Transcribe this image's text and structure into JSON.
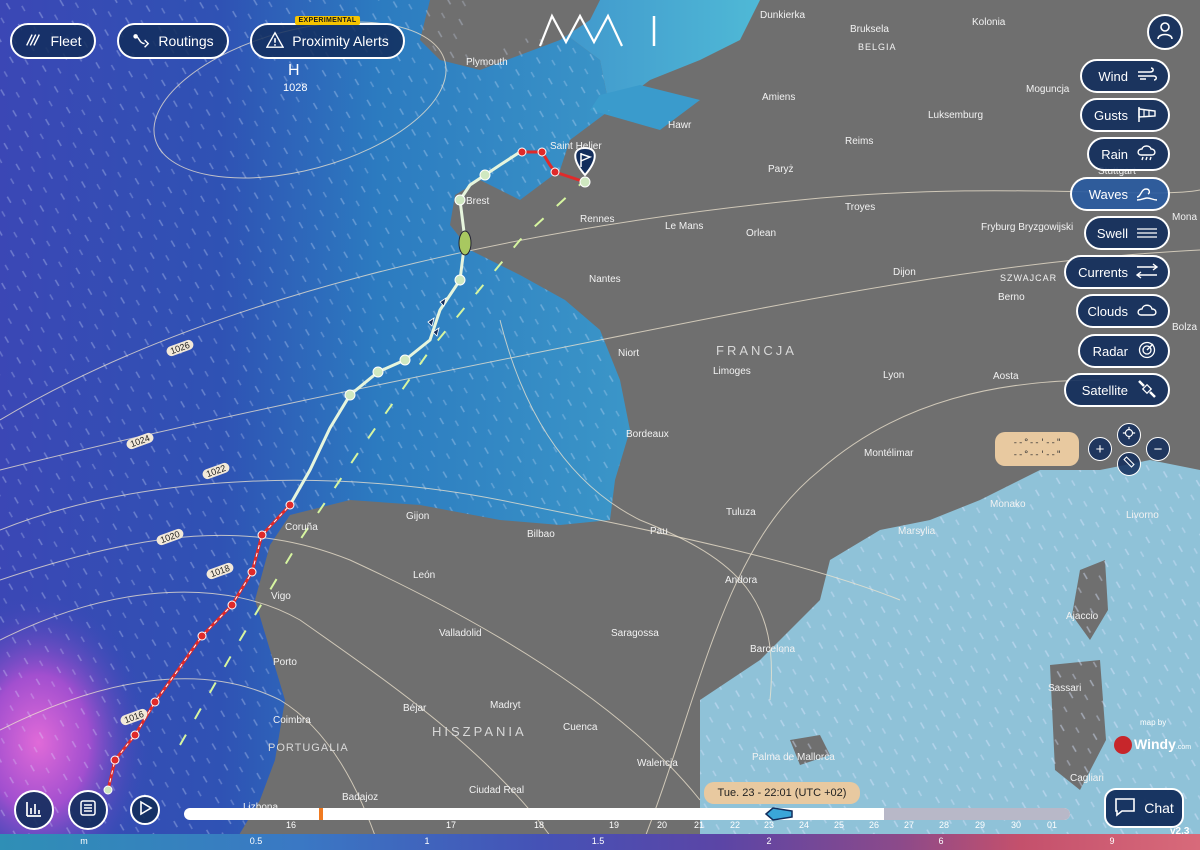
{
  "header": {
    "fleet_label": "Fleet",
    "routings_label": "Routings",
    "proximity_label": "Proximity Alerts",
    "proximity_badge": "EXPERIMENTAL",
    "logo_text": "MWI"
  },
  "layers": [
    {
      "label": "Wind",
      "icon": "wind-icon"
    },
    {
      "label": "Gusts",
      "icon": "windsock-icon"
    },
    {
      "label": "Rain",
      "icon": "rain-cloud-icon"
    },
    {
      "label": "Waves",
      "icon": "waves-icon"
    },
    {
      "label": "Swell",
      "icon": "swell-icon"
    },
    {
      "label": "Currents",
      "icon": "currents-icon"
    },
    {
      "label": "Clouds",
      "icon": "cloud-icon"
    },
    {
      "label": "Radar",
      "icon": "radar-icon"
    },
    {
      "label": "Satellite",
      "icon": "satellite-icon"
    }
  ],
  "coords": {
    "line1": "--°--'--\"",
    "line2": "--°--'--\""
  },
  "pressure": {
    "symbol": "H",
    "value": "1028"
  },
  "isobars": [
    "1026",
    "1024",
    "1022",
    "1020",
    "1018",
    "1016"
  ],
  "places": {
    "plymouth": "Plymouth",
    "dunkierka": "Dunkierka",
    "bruksela": "Bruksela",
    "belgia": "BELGIA",
    "kolonia": "Kolonia",
    "moguncja": "Moguncja",
    "amiens": "Amiens",
    "hawr": "Hawr",
    "luksemburg": "Luksemburg",
    "reims": "Reims",
    "paryz": "Paryż",
    "saint_helier": "Saint Helier",
    "brest": "Brest",
    "rennes": "Rennes",
    "le_mans": "Le Mans",
    "orlean": "Orlean",
    "troyes": "Troyes",
    "stuttgart": "Stuttgart",
    "fryburg": "Fryburg Bryzgowijski",
    "monachium": "Mona",
    "nantes": "Nantes",
    "dijon": "Dijon",
    "szwajcaria": "SZWAJCAR",
    "berno": "Berno",
    "bolzano": "Bolza",
    "niort": "Niort",
    "limoges": "Limoges",
    "lyon": "Lyon",
    "aosta": "Aosta",
    "bordeaux": "Bordeaux",
    "montelimar": "Montélimar",
    "tuluza": "Tuluza",
    "monako": "Monako",
    "livorno": "Livorno",
    "marsylia": "Marsylia",
    "pau": "Pau",
    "bilbao": "Bilbao",
    "gijon": "Gijon",
    "coruna": "Coruña",
    "vigo": "Vigo",
    "leon": "León",
    "andora": "Andora",
    "ajaccio": "Ajaccio",
    "valladolid": "Valladolid",
    "saragossa": "Saragossa",
    "barcelona": "Barcelona",
    "porto": "Porto",
    "sassari": "Sassari",
    "madryt": "Madryt",
    "bejar": "Béjar",
    "cuenca": "Cuenca",
    "coimbra": "Coimbra",
    "palma": "Palma de Mallorca",
    "walencja": "Walencja",
    "cagliari": "Cagliari",
    "ciudad_real": "Ciudad Real",
    "badajoz": "Badajoz",
    "lizbona": "Lizbona"
  },
  "countries": {
    "francja": "FRANCJA",
    "hiszpania": "HISZPANIA",
    "portugalia": "PORTUGALIA"
  },
  "attribution": {
    "map_by": "map by",
    "brand": "Windy",
    "brand_suffix": ".com"
  },
  "time": {
    "current": "Tue. 23 - 22:01 (UTC +02)"
  },
  "timeline_days": [
    "16",
    "17",
    "18",
    "19",
    "20",
    "21",
    "22",
    "23",
    "24",
    "25",
    "26",
    "27",
    "28",
    "29",
    "30",
    "01"
  ],
  "scale": {
    "unit": "m",
    "values": [
      "0.5",
      "1",
      "1.5",
      "2",
      "6",
      "9"
    ]
  },
  "chat_label": "Chat",
  "version": "v2.3",
  "colors": {
    "ocean_dark": "#1f3f9a",
    "ocean_light": "#3aa6d0",
    "land": "#6f6f6f",
    "route_red": "#e02a2a",
    "route_green": "#cfe8c0",
    "button_bg": "#122d5c"
  }
}
